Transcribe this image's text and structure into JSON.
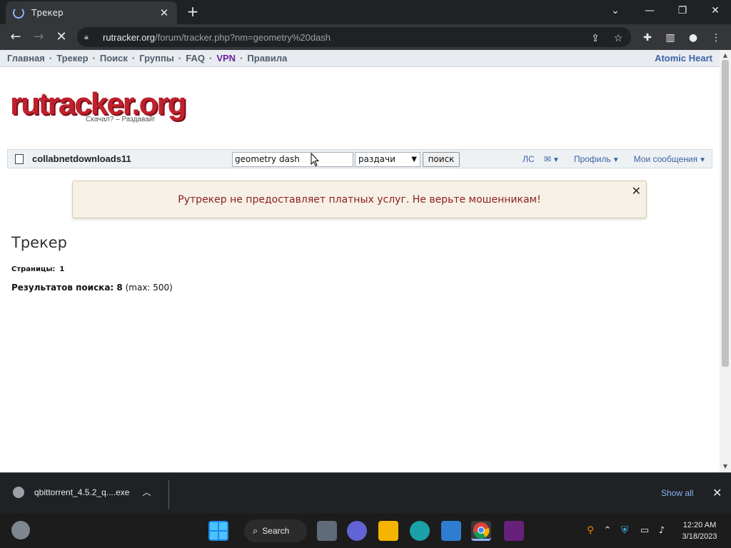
{
  "browser": {
    "tab_title": "Трекер",
    "url_host": "rutracker.org",
    "url_path": "/forum/tracker.php?nm=geometry%20dash"
  },
  "site": {
    "nav": [
      {
        "label": "Главная"
      },
      {
        "label": "Трекер"
      },
      {
        "label": "Поиск"
      },
      {
        "label": "Группы"
      },
      {
        "label": "FAQ"
      },
      {
        "label": "VPN"
      },
      {
        "label": "Правила"
      }
    ],
    "nav_right": "Atomic Heart",
    "logo_text": "rutracker.org",
    "logo_tagline": "Скачал? – Раздавай!",
    "username": "collabnetdownloads11",
    "search_value": "geometry dash",
    "search_scope": "раздачи",
    "search_button": "поиск",
    "user_links": [
      "ЛС",
      "Профиль",
      "Мои сообщения"
    ],
    "notice": "Рутрекер не предоставляет платных услуг. Не верьте мошенникам!",
    "heading": "Трекер",
    "pages_label": "Страницы:",
    "pages_value": "1",
    "results_label": "Результатов поиска: 8",
    "results_max": "(max: 500)"
  },
  "downloads": {
    "filename": "qbittorrent_4.5.2_q....exe",
    "show_all": "Show all"
  },
  "taskbar": {
    "search_label": "Search",
    "time": "12:20 AM",
    "date": "3/18/2023"
  },
  "colors": {
    "nav_link": "#4e5d6b",
    "vpn_link": "#6b1f9e",
    "accent_link": "#3b64a5",
    "notice_text": "#8a1f1f"
  }
}
